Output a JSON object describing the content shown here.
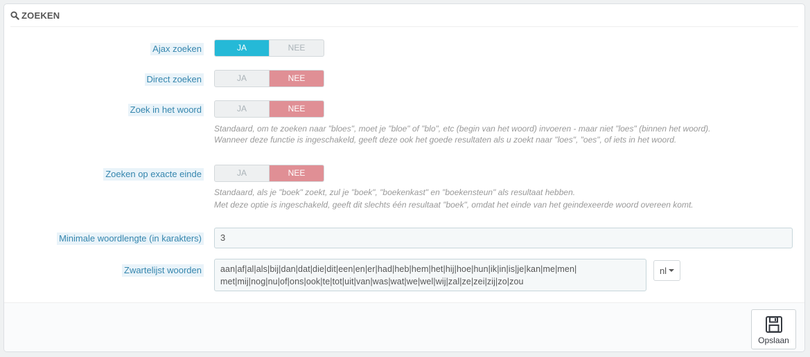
{
  "panel": {
    "title": "ZOEKEN",
    "icon": "search-icon"
  },
  "switches": {
    "yes_label": "JA",
    "no_label": "NEE",
    "ajax": {
      "label": "Ajax zoeken",
      "value": "JA"
    },
    "direct": {
      "label": "Direct zoeken",
      "value": "NEE"
    },
    "in_word": {
      "label": "Zoek in het woord",
      "value": "NEE",
      "help_1": "Standaard, om te zoeken naar \"bloes\", moet je \"bloe\" of \"blo\", etc (begin van het woord) invoeren - maar niet \"loes\" (binnen het woord).",
      "help_2": "Wanneer deze functie is ingeschakeld, geeft deze ook het goede resultaten als u zoekt naar \"loes\", \"oes\", of iets in het woord."
    },
    "exact_end": {
      "label": "Zoeken op exacte einde",
      "value": "NEE",
      "help_1": "Standaard, als je \"boek\" zoekt, zul je \"boek\", \"boekenkast\" en \"boekensteun\" als resultaat hebben.",
      "help_2": "Met deze optie is ingeschakeld, geeft dit slechts één resultaat \"boek\", omdat het einde van het geindexeerde woord overeen komt."
    }
  },
  "min_length": {
    "label": "Minimale woordlengte (in karakters)",
    "value": "3"
  },
  "blacklist": {
    "label": "Zwartelijst woorden",
    "line_1": "aan|af|al|als|bij|dan|dat|die|dit|een|en|er|had|heb|hem|het|hij|hoe|hun|ik|in|is|je|kan|me|men|",
    "line_2": "met|mij|nog|nu|of|ons|ook|te|tot|uit|van|was|wat|we|wel|wij|zal|ze|zei|zij|zo|zou",
    "language": "nl"
  },
  "footer": {
    "save_label": "Opslaan"
  },
  "colors": {
    "accent": "#25b9d7",
    "no_active": "#e08f95",
    "label_text": "#3586ae"
  }
}
